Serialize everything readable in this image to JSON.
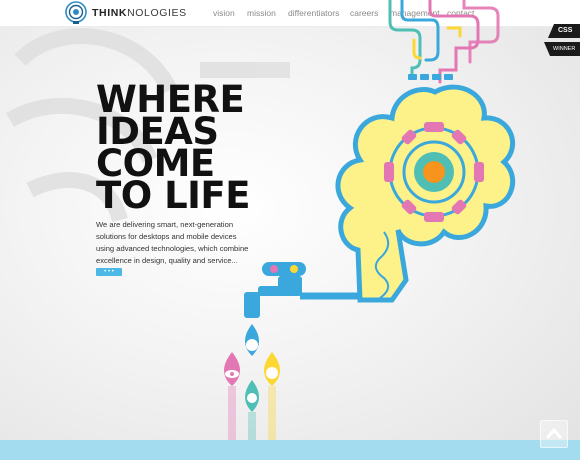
{
  "header": {
    "brand_bold": "THINK",
    "brand_rest": "NOLOGIES",
    "nav": [
      "vision",
      "mission",
      "differentiators",
      "careers",
      "management",
      "contact"
    ]
  },
  "hero": {
    "headline": [
      "WHERE",
      "IDEAS",
      "COME",
      "TO LIFE"
    ],
    "description": "We are delivering smart, next-generation solutions for desktops and mobile devices using advanced technologies, which combine excellence in design, quality and service...",
    "more_label": "• • •"
  },
  "badge": {
    "top": "CSS",
    "bottom": "WINNER"
  },
  "icons": [
    "brain-gear-icon",
    "faucet-icon",
    "users-icon",
    "eye-icon",
    "clock-icon",
    "lightbulb-icon",
    "arrow-up-icon"
  ],
  "colors": {
    "blue": "#3aa8dc",
    "yellow": "#fdf18a",
    "pink": "#e377b4",
    "teal": "#4fbfb5",
    "orange": "#f7941d",
    "band": "#a3dcef"
  }
}
